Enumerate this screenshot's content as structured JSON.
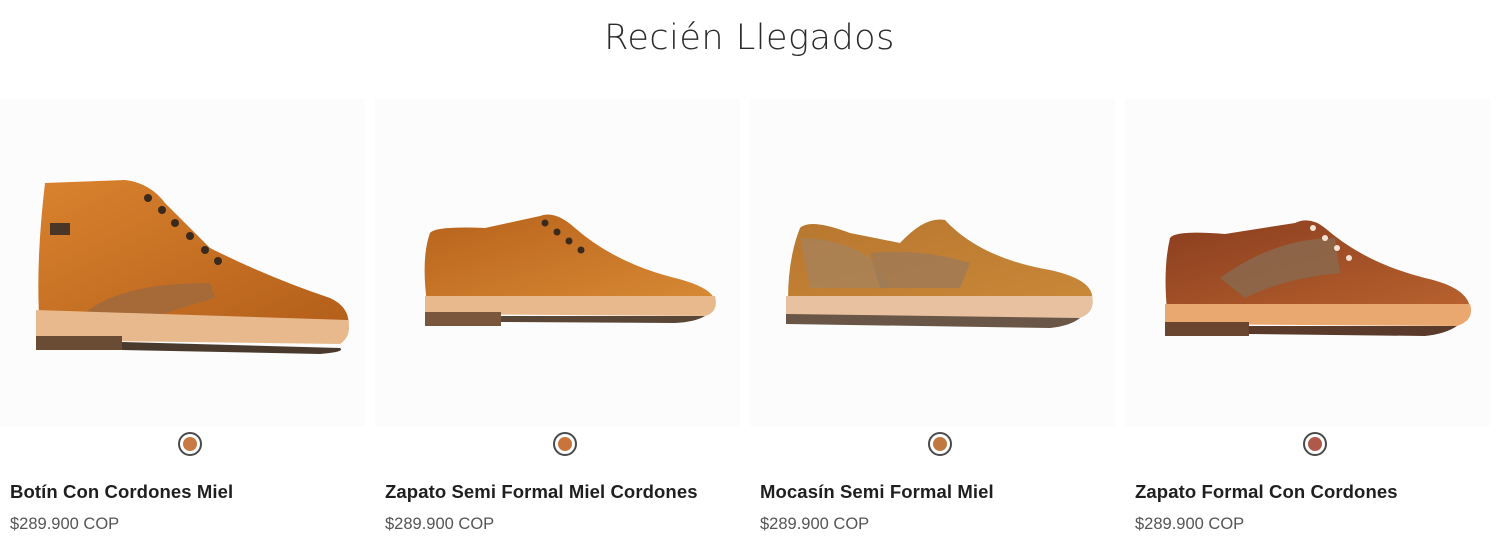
{
  "section": {
    "title": "Recién Llegados"
  },
  "products": [
    {
      "name": "Botín Con Cordones Miel",
      "price": "$289.900 COP",
      "swatch_color": "#c87843",
      "image": "boot-image"
    },
    {
      "name": "Zapato Semi Formal Miel Cordones",
      "price": "$289.900 COP",
      "swatch_color": "#c8743c",
      "image": "derby-shoe-image"
    },
    {
      "name": "Mocasín Semi Formal Miel",
      "price": "$289.900 COP",
      "swatch_color": "#c0783f",
      "image": "loafer-image"
    },
    {
      "name": "Zapato Formal Con Cordones",
      "price": "$289.900 COP",
      "swatch_color": "#b0594a",
      "image": "oxford-shoe-image"
    }
  ],
  "colors": {
    "honey_leather": "#c8721f",
    "sole": "#e7b88a",
    "brown_leather": "#9b4a2a",
    "text": "#1f1f1f",
    "price_text": "#555555"
  }
}
